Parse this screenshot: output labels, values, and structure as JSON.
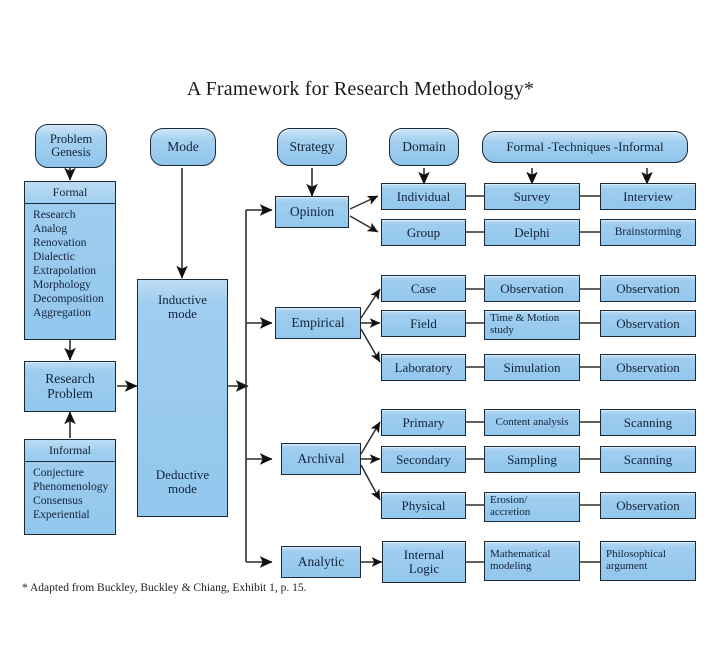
{
  "title": "A Framework for Research Methodology*",
  "footnote": "* Adapted from Buckley, Buckley & Chiang, Exhibit 1, p. 15.",
  "colors": {
    "node_fill": "#93c7ee",
    "node_fill_light": "#bcdcf5",
    "node_border": "#1b2a38",
    "background": "#ffffff",
    "text": "#12233a"
  },
  "headers": {
    "problem_genesis": "Problem\nGenesis",
    "problem_genesis_line1": "Problem",
    "problem_genesis_line2": "Genesis",
    "mode": "Mode",
    "strategy": "Strategy",
    "domain": "Domain",
    "techniques": "Formal -Techniques -Informal"
  },
  "genesis": {
    "formal": {
      "header": "Formal",
      "items": [
        "Research",
        "Analog",
        "Renovation",
        "Dialectic",
        "Extrapolation",
        "Morphology",
        "Decomposition",
        "Aggregation"
      ]
    },
    "research_problem_line1": "Research",
    "research_problem_line2": "Problem",
    "informal": {
      "header": "Informal",
      "items": [
        "Conjecture",
        "Phenomenology",
        "Consensus",
        "Experiential"
      ]
    }
  },
  "mode_box": {
    "inductive_line1": "Inductive",
    "inductive_line2": "mode",
    "deductive_line1": "Deductive",
    "deductive_line2": "mode"
  },
  "strategies": [
    {
      "name": "Opinion",
      "rows": [
        {
          "domain": "Individual",
          "formal": "Survey",
          "informal": "Interview"
        },
        {
          "domain": "Group",
          "formal": "Delphi",
          "informal": "Brainstorming"
        }
      ]
    },
    {
      "name": "Empirical",
      "rows": [
        {
          "domain": "Case",
          "formal": "Observation",
          "informal": "Observation"
        },
        {
          "domain": "Field",
          "formal": "Time & Motion\nstudy",
          "formal_line1": "Time & Motion",
          "formal_line2": "study",
          "informal": "Observation"
        },
        {
          "domain": "Laboratory",
          "formal": "Simulation",
          "informal": "Observation"
        }
      ]
    },
    {
      "name": "Archival",
      "rows": [
        {
          "domain": "Primary",
          "formal": "Content analysis",
          "informal": "Scanning"
        },
        {
          "domain": "Secondary",
          "formal": "Sampling",
          "informal": "Scanning"
        },
        {
          "domain": "Physical",
          "formal": "Erosion/\naccretion",
          "formal_line1": "Erosion/",
          "formal_line2": "accretion",
          "informal": "Observation"
        }
      ]
    },
    {
      "name": "Analytic",
      "rows": [
        {
          "domain": "Internal\nLogic",
          "domain_line1": "Internal",
          "domain_line2": "Logic",
          "formal": "Mathematical\nmodeling",
          "formal_line1": "Mathematical",
          "formal_line2": "modeling",
          "informal": "Philosophical\nargument",
          "informal_line1": "Philosophical",
          "informal_line2": "argument"
        }
      ]
    }
  ]
}
